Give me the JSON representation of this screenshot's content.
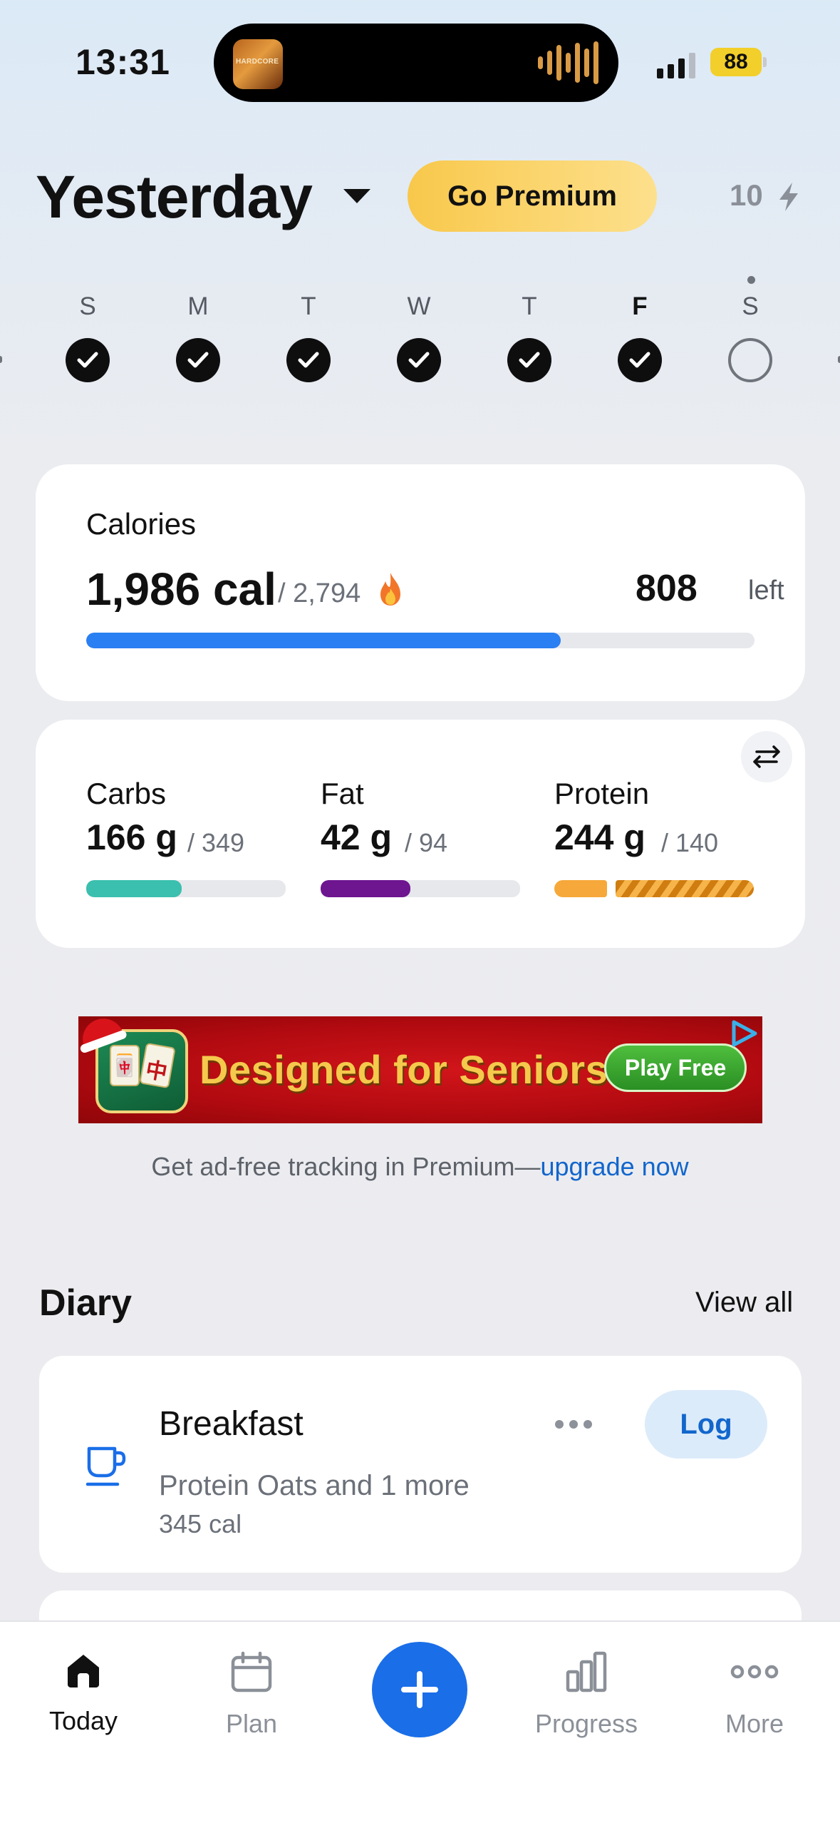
{
  "status_bar": {
    "time": "13:31",
    "island_art_text": "HARDCORE",
    "battery": "88"
  },
  "header": {
    "title": "Yesterday",
    "premium_label": "Go Premium",
    "streak_count": "10",
    "streak_icon": "bolt-icon"
  },
  "week": {
    "days": [
      {
        "letter": "S",
        "state": "done"
      },
      {
        "letter": "M",
        "state": "done"
      },
      {
        "letter": "T",
        "state": "done"
      },
      {
        "letter": "W",
        "state": "done"
      },
      {
        "letter": "T",
        "state": "done"
      },
      {
        "letter": "F",
        "state": "done",
        "selected": true
      },
      {
        "letter": "S",
        "state": "empty",
        "today": true
      }
    ]
  },
  "calories": {
    "label": "Calories",
    "value": "1,986 cal",
    "goal": "/ 2,794",
    "left_value": "808",
    "left_label": "left",
    "progress": 0.71,
    "bar_color": "#2a7ff2"
  },
  "macros": [
    {
      "name": "Carbs",
      "value": "166 g",
      "goal": "/ 349",
      "progress": 0.48,
      "color": "#3bbfae"
    },
    {
      "name": "Fat",
      "value": "42 g",
      "goal": "/ 94",
      "progress": 0.45,
      "color": "#6e1590"
    },
    {
      "name": "Protein",
      "value": "244 g",
      "goal": "/ 140",
      "progress": 1.0,
      "color": "#f6a83a",
      "over": true
    }
  ],
  "ad": {
    "title": "Designed for Seniors",
    "cta": "Play Free",
    "tile_1": "🀄",
    "tile_2": "中",
    "note_prefix": "Get ad-free tracking in Premium—",
    "note_link": "upgrade now"
  },
  "diary": {
    "title": "Diary",
    "view_all": "View all",
    "meals": [
      {
        "name": "Breakfast",
        "items": "Protein Oats and 1 more",
        "calories": "345 cal",
        "log_label": "Log",
        "icon": "coffee-cup-icon"
      }
    ]
  },
  "tabbar": {
    "tabs": [
      {
        "label": "Today",
        "icon": "home-icon",
        "active": true
      },
      {
        "label": "Plan",
        "icon": "calendar-icon"
      },
      {
        "label": "Progress",
        "icon": "bar-chart-icon"
      },
      {
        "label": "More",
        "icon": "more-dots-icon"
      }
    ],
    "fab_icon": "plus-icon"
  }
}
